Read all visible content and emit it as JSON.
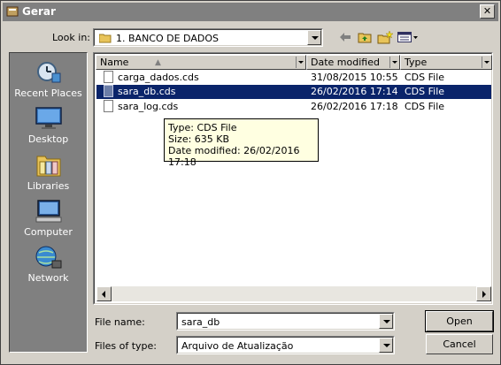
{
  "window": {
    "title": "Gerar"
  },
  "lookin": {
    "label": "Look in:",
    "value": "1. BANCO DE DADOS"
  },
  "places": [
    {
      "label": "Recent Places"
    },
    {
      "label": "Desktop"
    },
    {
      "label": "Libraries"
    },
    {
      "label": "Computer"
    },
    {
      "label": "Network"
    }
  ],
  "columns": {
    "name": "Name",
    "date": "Date modified",
    "type": "Type"
  },
  "files": [
    {
      "name": "carga_dados.cds",
      "date": "31/08/2015 10:55",
      "type": "CDS File",
      "selected": false
    },
    {
      "name": "sara_db.cds",
      "date": "26/02/2016 17:14",
      "type": "CDS File",
      "selected": true
    },
    {
      "name": "sara_log.cds",
      "date": "26/02/2016 17:18",
      "type": "CDS File",
      "selected": false
    }
  ],
  "tooltip": {
    "type": "Type: CDS File",
    "size": "Size: 635 KB",
    "date": "Date modified: 26/02/2016 17:18"
  },
  "filename": {
    "label": "File name:",
    "value": "sara_db"
  },
  "filetype": {
    "label": "Files of type:",
    "value": "Arquivo de Atualização"
  },
  "buttons": {
    "open": "Open",
    "cancel": "Cancel"
  },
  "colors": {
    "selection": "#0a246a",
    "tooltip_bg": "#ffffe1",
    "places_bg": "#808080"
  }
}
